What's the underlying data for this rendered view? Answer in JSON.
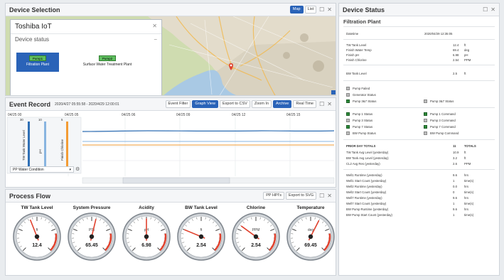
{
  "device_selection": {
    "title": "Device Selection",
    "map_btn": "Map",
    "list_btn": "List",
    "overlay_title": "Toshiba IoT",
    "overlay_subtitle": "Device status",
    "devices": [
      {
        "pump": "Pump1",
        "name": "Filtration Plant",
        "selected": true
      },
      {
        "pump": "Pump2",
        "name": "Surface Water Treatment Plant",
        "selected": false
      }
    ]
  },
  "event_record": {
    "title": "Event Record",
    "range": "2020/4/27 05:55:58 - 2020/4/29 12:00:01",
    "buttons": [
      "Event Filter",
      "Graph View",
      "Export to CSV",
      "Zoom In",
      "Archive",
      "Real Time"
    ],
    "active_buttons": [
      "Graph View",
      "Archive"
    ],
    "time_ticks": [
      "04/25 00",
      "04/25 05",
      "04/25 06",
      "04/25 09",
      "04/25 12",
      "04/25 15"
    ],
    "axis_labels": [
      "TW Tank Water Level",
      "pH",
      "Finish Chlorine"
    ],
    "axis_top": [
      "30",
      "10",
      "5"
    ],
    "axis_bottom": [
      "0",
      "0",
      "0"
    ],
    "dropdown": "PP Water Condition"
  },
  "process_flow": {
    "title": "Process Flow",
    "btn_pp": "PP HPI's",
    "btn_export": "Export to SVG",
    "gauges": [
      {
        "label": "TW Tank Level",
        "unit": "ft",
        "value": "12.4",
        "fraction": 0.42
      },
      {
        "label": "System Pressure",
        "unit": "PSI",
        "value": "65.45",
        "fraction": 0.55
      },
      {
        "label": "Acidity",
        "unit": "pH",
        "value": "6.98",
        "fraction": 0.5
      },
      {
        "label": "BW Tank Level",
        "unit": "ft",
        "value": "2.54",
        "fraction": 0.25
      },
      {
        "label": "Chlorine",
        "unit": "PPM",
        "value": "2.54",
        "fraction": 0.3
      },
      {
        "label": "Temperature",
        "unit": "deg",
        "value": "69.45",
        "fraction": 0.6
      }
    ]
  },
  "device_status": {
    "title": "Device Status",
    "plant": "Filtration Plant",
    "datetime_label": "Datetime",
    "datetime_value": "2020/04/29 12:35:05",
    "readings": [
      {
        "label": "TW Tank Level",
        "value": "12.4",
        "unit": "ft"
      },
      {
        "label": "Finish Water Temp",
        "value": "69.4",
        "unit": "deg"
      },
      {
        "label": "Finish pH",
        "value": "6.98",
        "unit": "pH"
      },
      {
        "label": "Finish Chlorine",
        "value": "2.54",
        "unit": "PPM"
      }
    ],
    "bw_tank": {
      "label": "BW Tank Level",
      "value": "2.5",
      "unit": "ft"
    },
    "statuses_left": [
      {
        "label": "Pump Failed",
        "on": false
      },
      {
        "label": "Generator Status",
        "on": false
      },
      {
        "label": "Pump 3&7 Status",
        "on": true
      }
    ],
    "status_right": {
      "label": "Pump 3&7 Status",
      "on": false
    },
    "pump_pairs": [
      {
        "left": "Pump 1 Status",
        "left_on": true,
        "right": "Pump 1 Command",
        "right_on": true
      },
      {
        "left": "Pump 3 Status",
        "left_on": false,
        "right": "Pump 3 Command",
        "right_on": false
      },
      {
        "left": "Pump 7 Status",
        "left_on": true,
        "right": "Pump 7 Command",
        "right_on": true
      },
      {
        "left": "BW Pump Status",
        "left_on": false,
        "right": "BW Pump Command",
        "right_on": false
      }
    ],
    "totals_header": {
      "label": "PRIOR DAY TOTALS",
      "value": "11",
      "unit": "TOTALS"
    },
    "totals": [
      {
        "label": "TW Tank Avg Level (yesterday)",
        "value": "10.9",
        "unit": "ft"
      },
      {
        "label": "BW Tank Avg Level (yesterday)",
        "value": "3.2",
        "unit": "ft"
      },
      {
        "label": "CL2 Avg Res (yesterday)",
        "value": "2.6",
        "unit": "PPM"
      }
    ],
    "runtimes": [
      {
        "label": "Well1 Runtime (yesterday)",
        "value": "9.6",
        "unit": "hrs"
      },
      {
        "label": "Well1 Start Count (yesterday)",
        "value": "1",
        "unit": "time(s)"
      },
      {
        "label": "Well2 Runtime (yesterday)",
        "value": "0.0",
        "unit": "hrs"
      },
      {
        "label": "Well2 Start Count (yesterday)",
        "value": "0",
        "unit": "time(s)"
      },
      {
        "label": "Well7 Runtime (yesterday)",
        "value": "9.6",
        "unit": "hrs"
      },
      {
        "label": "Well7 Start Count (yesterday)",
        "value": "1",
        "unit": "time(s)"
      },
      {
        "label": "BW Pump Runtime (yesterday)",
        "value": "9.6",
        "unit": "hrs"
      },
      {
        "label": "BW Pump Start Count (yesterday)",
        "value": "1",
        "unit": "time(s)"
      }
    ]
  },
  "colors": {
    "accent": "#2a63b8",
    "status_on": "#2e8b3a",
    "status_off": "#bdbdbd",
    "series_a": "#2f6fb5",
    "series_b": "#88b4e0",
    "series_c": "#f39c34",
    "needle": "#e0412d"
  }
}
